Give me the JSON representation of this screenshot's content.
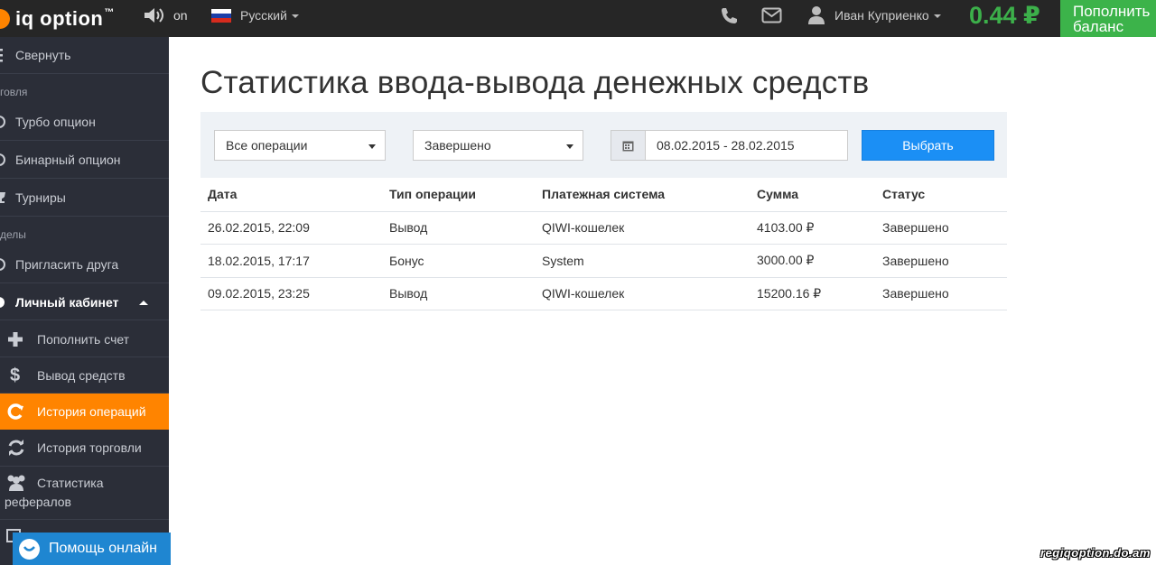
{
  "header": {
    "logo_text": "iq option",
    "logo_tm": "™",
    "sound_label": "on",
    "language": "Русский",
    "user_name": "Иван Куприенко",
    "balance": "0.44 ₽",
    "deposit_label": "Пополнить баланс",
    "flag_colors": [
      "#ffffff",
      "#1c3fa8",
      "#d52b1e"
    ],
    "icons": [
      "speaker-icon",
      "phone-icon",
      "envelope-icon",
      "user-icon"
    ]
  },
  "sidebar": {
    "collapse": "Свернуть",
    "section_trading": "говля",
    "turbo": "Турбо опцион",
    "binary": "Бинарный опцион",
    "tournaments": "Турниры",
    "section_partners": "делы",
    "invite": "Пригласить друга",
    "cabinet": "Личный кабинет",
    "deposit": "Пополнить счет",
    "withdraw": "Вывод средств",
    "ops_history": "История операций",
    "trade_history": "История торговли",
    "referral_stats_1": "Статистика",
    "referral_stats_2": "рефералов",
    "help": "Помощь онлайн"
  },
  "main": {
    "title": "Статистика ввода-вывода денежных средств",
    "filter_operation": "Все операции",
    "filter_status": "Завершено",
    "date_range": "08.02.2015 - 28.02.2015",
    "select_button": "Выбрать",
    "columns": [
      "Дата",
      "Тип операции",
      "Платежная система",
      "Сумма",
      "Статус"
    ],
    "rows": [
      [
        "26.02.2015, 22:09",
        "Вывод",
        "QIWI-кошелек",
        "4103.00 ₽",
        "Завершено"
      ],
      [
        "18.02.2015, 17:17",
        "Бонус",
        "System",
        "3000.00 ₽",
        "Завершено"
      ],
      [
        "09.02.2015, 23:25",
        "Вывод",
        "QIWI-кошелек",
        "15200.16 ₽",
        "Завершено"
      ]
    ]
  },
  "watermark": "regiqoption.do.am",
  "colors": {
    "accent_orange": "#ff8400",
    "balance_green": "#3cb04a",
    "primary_blue": "#1b8ff5",
    "sidebar_bg": "#2b2e38",
    "topbar_bg": "#262626"
  }
}
